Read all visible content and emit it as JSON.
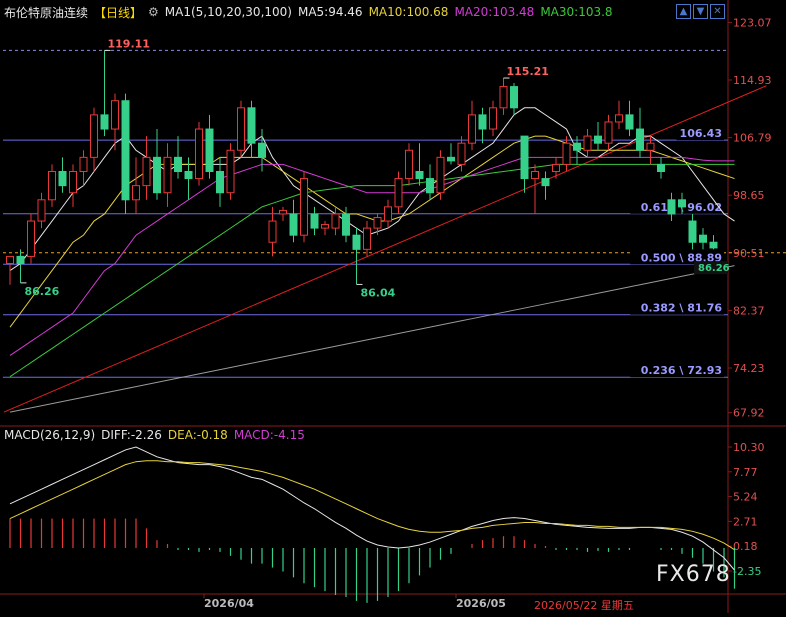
{
  "header": {
    "title": "布伦特原油连续",
    "period": "【日线】",
    "gear_icon": "gear-icon",
    "ma_label": "MA1(5,10,20,30,100)",
    "ma_values": [
      {
        "label": "MA5:94.46",
        "color": "#e6e6e6"
      },
      {
        "label": "MA10:100.68",
        "color": "#e6d23c"
      },
      {
        "label": "MA20:103.48",
        "color": "#d23cd2"
      },
      {
        "label": "MA30:103.8",
        "color": "#3cc83c"
      }
    ]
  },
  "toolbar": {
    "up": "▲",
    "down": "▼",
    "close": "✕"
  },
  "macd_header": {
    "label": "MACD(26,12,9)",
    "diff": "DIFF:-2.26",
    "dea": "DEA:-0.18",
    "macd": "MACD:-4.15"
  },
  "x_labels": [
    "2026/04",
    "2026/05"
  ],
  "current_date": "2026/05/22 星期五",
  "watermark": "FX678",
  "colors": {
    "up": "#e83838",
    "down": "#36d08a",
    "ma5": "#e6e6e6",
    "ma10": "#e6d23c",
    "ma20": "#d23cd2",
    "ma30": "#3cc83c",
    "ma100": "#9a9a9a",
    "trend": "#e02020",
    "fib": "#6e6ee6"
  },
  "chart_data": [
    {
      "type": "candlestick",
      "title": "布伦特原油连续",
      "y_ticks": [
        123.07,
        114.93,
        106.79,
        98.65,
        90.51,
        82.37,
        74.23,
        67.92
      ],
      "ylim": [
        67.92,
        123.07
      ],
      "candles": [
        {
          "o": 89,
          "h": 90,
          "l": 86,
          "c": 90
        },
        {
          "o": 90,
          "h": 91,
          "l": 86.26,
          "c": 89
        },
        {
          "o": 90,
          "h": 96,
          "l": 89,
          "c": 95
        },
        {
          "o": 95,
          "h": 99,
          "l": 94,
          "c": 98
        },
        {
          "o": 98,
          "h": 103,
          "l": 97,
          "c": 102
        },
        {
          "o": 102,
          "h": 104,
          "l": 99,
          "c": 100
        },
        {
          "o": 99,
          "h": 103,
          "l": 97,
          "c": 102
        },
        {
          "o": 102,
          "h": 105,
          "l": 100,
          "c": 104
        },
        {
          "o": 104,
          "h": 111,
          "l": 102,
          "c": 110
        },
        {
          "o": 110,
          "h": 119.11,
          "l": 107,
          "c": 108
        },
        {
          "o": 108,
          "h": 113,
          "l": 105,
          "c": 112
        },
        {
          "o": 112,
          "h": 113,
          "l": 96,
          "c": 98
        },
        {
          "o": 98,
          "h": 104,
          "l": 96,
          "c": 100
        },
        {
          "o": 100,
          "h": 107,
          "l": 98,
          "c": 104
        },
        {
          "o": 104,
          "h": 108,
          "l": 98,
          "c": 99
        },
        {
          "o": 99,
          "h": 106,
          "l": 97,
          "c": 104
        },
        {
          "o": 104,
          "h": 107,
          "l": 101,
          "c": 102
        },
        {
          "o": 102,
          "h": 104,
          "l": 98,
          "c": 101
        },
        {
          "o": 101,
          "h": 109,
          "l": 100,
          "c": 108
        },
        {
          "o": 108,
          "h": 110,
          "l": 101,
          "c": 102
        },
        {
          "o": 102,
          "h": 104,
          "l": 97,
          "c": 99
        },
        {
          "o": 99,
          "h": 106,
          "l": 98,
          "c": 105
        },
        {
          "o": 105,
          "h": 112,
          "l": 104,
          "c": 111
        },
        {
          "o": 111,
          "h": 112,
          "l": 104,
          "c": 106
        },
        {
          "o": 106,
          "h": 108,
          "l": 102,
          "c": 104
        },
        {
          "o": 92,
          "h": 97,
          "l": 90,
          "c": 95
        },
        {
          "o": 96,
          "h": 97,
          "l": 95,
          "c": 96.5
        },
        {
          "o": 96,
          "h": 98,
          "l": 92,
          "c": 93
        },
        {
          "o": 93,
          "h": 102,
          "l": 92,
          "c": 101
        },
        {
          "o": 96,
          "h": 97,
          "l": 93,
          "c": 94
        },
        {
          "o": 94,
          "h": 95,
          "l": 93,
          "c": 94.5
        },
        {
          "o": 94,
          "h": 97,
          "l": 93,
          "c": 96
        },
        {
          "o": 96,
          "h": 97,
          "l": 92,
          "c": 93
        },
        {
          "o": 93,
          "h": 94,
          "l": 86.04,
          "c": 91
        },
        {
          "o": 91,
          "h": 95,
          "l": 90,
          "c": 94
        },
        {
          "o": 94,
          "h": 96,
          "l": 93,
          "c": 95.5
        },
        {
          "o": 95,
          "h": 98,
          "l": 94,
          "c": 97
        },
        {
          "o": 97,
          "h": 102,
          "l": 96,
          "c": 101
        },
        {
          "o": 101,
          "h": 106,
          "l": 100,
          "c": 105
        },
        {
          "o": 102,
          "h": 106,
          "l": 100,
          "c": 101
        },
        {
          "o": 101,
          "h": 103,
          "l": 98,
          "c": 99
        },
        {
          "o": 99,
          "h": 105,
          "l": 98,
          "c": 104
        },
        {
          "o": 104,
          "h": 106,
          "l": 103,
          "c": 103.5
        },
        {
          "o": 103,
          "h": 107,
          "l": 102,
          "c": 106
        },
        {
          "o": 106,
          "h": 112,
          "l": 105,
          "c": 110
        },
        {
          "o": 110,
          "h": 111,
          "l": 106,
          "c": 108
        },
        {
          "o": 108,
          "h": 112,
          "l": 107,
          "c": 111
        },
        {
          "o": 111,
          "h": 115.21,
          "l": 110,
          "c": 114
        },
        {
          "o": 114,
          "h": 114.5,
          "l": 110,
          "c": 111
        },
        {
          "o": 107,
          "h": 107,
          "l": 99,
          "c": 101
        },
        {
          "o": 101,
          "h": 103,
          "l": 96,
          "c": 102
        },
        {
          "o": 101,
          "h": 102,
          "l": 98,
          "c": 100
        },
        {
          "o": 102,
          "h": 104,
          "l": 101,
          "c": 103
        },
        {
          "o": 103,
          "h": 107,
          "l": 102,
          "c": 106
        },
        {
          "o": 106,
          "h": 107,
          "l": 103,
          "c": 105
        },
        {
          "o": 105,
          "h": 108,
          "l": 104,
          "c": 107
        },
        {
          "o": 107,
          "h": 109,
          "l": 105,
          "c": 106
        },
        {
          "o": 106,
          "h": 110,
          "l": 105,
          "c": 109
        },
        {
          "o": 109,
          "h": 112,
          "l": 108,
          "c": 110
        },
        {
          "o": 110,
          "h": 112,
          "l": 107,
          "c": 108
        },
        {
          "o": 108,
          "h": 111,
          "l": 104,
          "c": 105
        },
        {
          "o": 105,
          "h": 107,
          "l": 103,
          "c": 106
        },
        {
          "o": 103,
          "h": 104,
          "l": 101,
          "c": 102
        },
        {
          "o": 98,
          "h": 99,
          "l": 95,
          "c": 96
        },
        {
          "o": 98,
          "h": 99,
          "l": 96,
          "c": 97
        },
        {
          "o": 95,
          "h": 96,
          "l": 91,
          "c": 92
        },
        {
          "o": 93,
          "h": 94,
          "l": 91,
          "c": 92
        },
        {
          "o": 92,
          "h": 93,
          "l": 91,
          "c": 91.2
        }
      ],
      "annotations": [
        {
          "text": "119.11",
          "price": 119.11,
          "color": "#ff6060"
        },
        {
          "text": "115.21",
          "price": 115.21,
          "color": "#ff6060"
        },
        {
          "text": "86.26",
          "price": 86.26,
          "color": "#36d08a"
        },
        {
          "text": "86.04",
          "price": 86.04,
          "color": "#36d08a"
        }
      ],
      "fib_levels": [
        {
          "label": "106.43",
          "price": 106.43
        },
        {
          "label": "0.618 \\ 96.02",
          "price": 96.02
        },
        {
          "label": "0.500 \\ 88.89",
          "price": 88.89
        },
        {
          "label": "0.382 \\ 81.76",
          "price": 81.76
        },
        {
          "label": "0.236 \\ 72.93",
          "price": 72.93
        }
      ],
      "high_line": 119.11,
      "current_line": 90.51,
      "price_tag": "86.26",
      "moving_averages": [
        {
          "name": "MA5",
          "values": [
            88,
            89,
            91,
            93,
            95,
            97,
            99,
            100,
            102,
            104,
            106,
            107,
            105,
            104,
            103,
            102,
            103,
            103,
            103,
            103,
            103,
            103,
            104,
            106,
            107,
            104,
            102,
            100,
            99,
            98,
            97,
            96,
            95,
            94,
            93,
            93.5,
            94,
            95,
            97,
            99,
            100,
            101,
            102,
            103,
            104,
            105,
            106,
            108,
            110,
            111,
            111,
            110,
            109,
            108,
            105,
            104,
            104,
            105,
            106,
            106,
            107,
            107,
            106,
            105,
            104,
            102,
            100,
            98,
            96,
            95
          ]
        },
        {
          "name": "MA10",
          "values": [
            80,
            82,
            84,
            86,
            88,
            90,
            92,
            93,
            95,
            96,
            98,
            100,
            101,
            102,
            103,
            103,
            103,
            103,
            103,
            103,
            104,
            104,
            104,
            104,
            104,
            103,
            102,
            101,
            100,
            99,
            98,
            97,
            96,
            96,
            95.5,
            95,
            95,
            95.5,
            96,
            97,
            98,
            99,
            100,
            101,
            102,
            103,
            104,
            105,
            106,
            106.5,
            107,
            107,
            106.5,
            106,
            105.5,
            105,
            105,
            105,
            105,
            105,
            105,
            105,
            104.5,
            104,
            103.5,
            103,
            102.5,
            102,
            101.5,
            101
          ]
        },
        {
          "name": "MA20",
          "values": [
            76,
            77,
            78,
            79,
            80,
            81,
            82,
            84,
            86,
            88,
            89,
            91,
            93,
            94,
            95,
            96,
            97,
            98,
            99,
            100,
            101,
            101.5,
            102,
            102.5,
            103,
            103,
            103,
            102.5,
            102,
            101.5,
            101,
            100.5,
            100,
            99.5,
            99,
            99,
            99,
            99,
            99,
            99,
            99.5,
            100,
            100.5,
            101,
            101.5,
            102,
            102.5,
            103,
            103.5,
            104,
            104,
            104,
            104,
            104,
            104,
            104,
            104,
            104,
            104,
            104,
            104,
            104,
            104,
            104,
            104,
            103.8,
            103.6,
            103.5,
            103.5,
            103.5
          ]
        },
        {
          "name": "MA30",
          "values": [
            73,
            74,
            75,
            76,
            77,
            78,
            79,
            80,
            81,
            82,
            83,
            84,
            85,
            86,
            87,
            88,
            89,
            90,
            91,
            92,
            93,
            94,
            95,
            96,
            97,
            97.5,
            98,
            98.5,
            99,
            99.2,
            99.4,
            99.6,
            99.8,
            100,
            100,
            100,
            100,
            100,
            100.2,
            100.4,
            100.6,
            100.8,
            101,
            101.2,
            101.4,
            101.6,
            101.8,
            102,
            102.2,
            102.4,
            102.6,
            102.8,
            103,
            103,
            103,
            103,
            103,
            103,
            103,
            103,
            103,
            103,
            103,
            103,
            103,
            103,
            103,
            103,
            103,
            103
          ]
        },
        {
          "name": "MA100",
          "values": [
            68,
            68.3,
            68.6,
            68.9,
            69.2,
            69.5,
            69.8,
            70.1,
            70.4,
            70.7,
            71,
            71.3,
            71.6,
            71.9,
            72.2,
            72.5,
            72.8,
            73.1,
            73.4,
            73.7,
            74,
            74.3,
            74.6,
            74.9,
            75.2,
            75.5,
            75.8,
            76.1,
            76.4,
            76.7,
            77,
            77.3,
            77.6,
            77.9,
            78.2,
            78.5,
            78.8,
            79.1,
            79.4,
            79.7,
            80,
            80.3,
            80.6,
            80.9,
            81.2,
            81.5,
            81.8,
            82.1,
            82.4,
            82.7,
            83,
            83.3,
            83.6,
            83.9,
            84.2,
            84.5,
            84.8,
            85.1,
            85.4,
            85.7,
            86,
            86.3,
            86.6,
            86.9,
            87.2,
            87.5,
            87.8,
            88.1,
            88.4,
            88.7
          ]
        }
      ],
      "trendline": [
        {
          "x": 0,
          "price": 68
        },
        {
          "x": 69,
          "price": 113
        }
      ]
    },
    {
      "type": "macd",
      "title": "MACD(26,12,9)",
      "y_ticks": [
        10.3,
        7.77,
        5.24,
        2.71,
        0.18,
        -2.35
      ],
      "ylim": [
        -4.9,
        10.9
      ],
      "diff": [
        4.5,
        5,
        5.5,
        6,
        6.5,
        7,
        7.5,
        8,
        8.5,
        9,
        9.5,
        10,
        10.3,
        9.8,
        9.3,
        9,
        8.7,
        8.6,
        8.5,
        8.5,
        8.3,
        8,
        7.6,
        7.2,
        7,
        6.5,
        6,
        5.3,
        4.6,
        4,
        3.3,
        2.6,
        2,
        1.3,
        0.7,
        0.3,
        0.1,
        0,
        0.1,
        0.3,
        0.6,
        1,
        1.4,
        1.8,
        2.2,
        2.5,
        2.8,
        3,
        3.1,
        3,
        2.8,
        2.6,
        2.4,
        2.3,
        2.2,
        2.1,
        2.05,
        2,
        2,
        2,
        2.1,
        2.1,
        2,
        1.9,
        1.6,
        1.2,
        0.6,
        -0.2,
        -1,
        -2.26
      ],
      "dea": [
        3,
        3.5,
        4,
        4.5,
        5,
        5.5,
        6,
        6.5,
        7,
        7.5,
        8,
        8.5,
        8.8,
        8.9,
        8.9,
        8.8,
        8.8,
        8.7,
        8.7,
        8.6,
        8.5,
        8.4,
        8.2,
        8,
        7.8,
        7.5,
        7.2,
        6.8,
        6.4,
        6,
        5.5,
        5,
        4.5,
        4,
        3.5,
        3,
        2.6,
        2.2,
        1.9,
        1.7,
        1.6,
        1.6,
        1.7,
        1.8,
        2,
        2.1,
        2.3,
        2.4,
        2.5,
        2.6,
        2.6,
        2.5,
        2.5,
        2.4,
        2.3,
        2.3,
        2.2,
        2.2,
        2.1,
        2.1,
        2.1,
        2.1,
        2.1,
        2,
        1.9,
        1.7,
        1.4,
        1,
        0.5,
        -0.18
      ],
      "macd": [
        3,
        3,
        3,
        3,
        3,
        3,
        3,
        3,
        3,
        3,
        3,
        3,
        3,
        2,
        0.8,
        0.4,
        -0.2,
        -0.2,
        -0.4,
        -0.2,
        -0.4,
        -0.8,
        -1.2,
        -1.6,
        -1.6,
        -2,
        -2.4,
        -3,
        -3.6,
        -4,
        -4.4,
        -4.8,
        -5,
        -5.4,
        -5.6,
        -5.4,
        -5,
        -4.4,
        -3.6,
        -2.8,
        -2,
        -1.2,
        -0.6,
        0,
        0.4,
        0.8,
        1,
        1.2,
        1.2,
        0.8,
        0.4,
        0.2,
        -0.2,
        -0.2,
        -0.2,
        -0.4,
        -0.3,
        -0.4,
        -0.2,
        -0.2,
        0,
        0,
        -0.2,
        -0.2,
        -0.6,
        -1,
        -1.6,
        -2.4,
        -3,
        -4.15
      ]
    }
  ]
}
